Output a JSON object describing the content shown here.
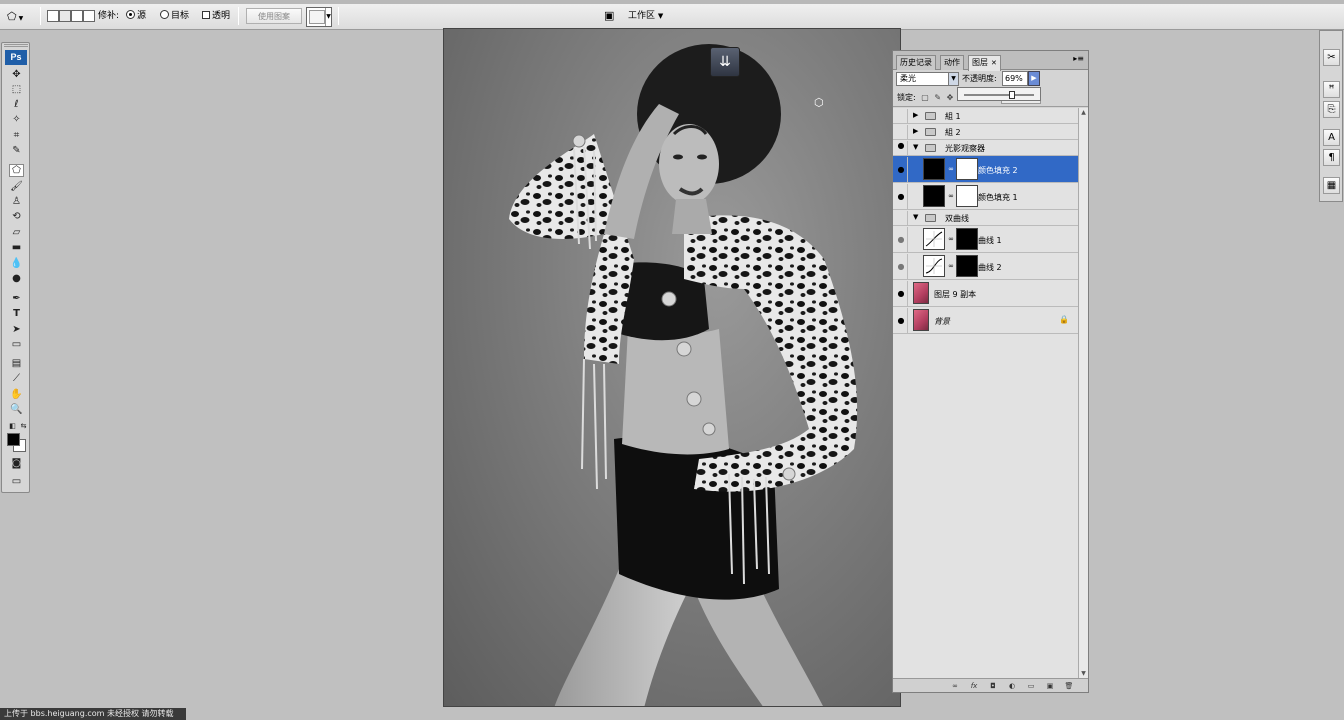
{
  "options_bar": {
    "repair_label": "修补:",
    "source_label": "源",
    "destination_label": "目标",
    "transparent_label": "透明",
    "use_pattern_label": "使用图案",
    "workspace_label": "工作区",
    "source_selected": true
  },
  "toolbox": {
    "logo": "Ps",
    "tools": [
      "move-icon",
      "marquee-icon",
      "lasso-icon",
      "magic-wand-icon",
      "crop-icon",
      "slice-icon",
      "patch-icon",
      "brush-icon",
      "clone-stamp-icon",
      "history-brush-icon",
      "eraser-icon",
      "gradient-icon",
      "blur-icon",
      "dodge-icon",
      "pen-icon",
      "type-icon",
      "path-select-icon",
      "shape-icon",
      "notes-icon",
      "eyedropper-icon",
      "hand-icon",
      "zoom-icon"
    ],
    "active_tool": "patch-icon",
    "foreground_color": "#000000",
    "background_color": "#ffffff"
  },
  "layers_panel": {
    "tabs": [
      {
        "label": "历史记录",
        "active": false
      },
      {
        "label": "动作",
        "active": false
      },
      {
        "label": "图层",
        "active": true
      }
    ],
    "blend_mode": "柔光",
    "opacity_label": "不透明度:",
    "opacity_value": "69%",
    "opacity_fraction": 0.69,
    "lock_label": "锁定:",
    "layers": [
      {
        "name": "組 1",
        "type": "group",
        "visible": false,
        "expanded": false,
        "indent": 0
      },
      {
        "name": "組 2",
        "type": "group",
        "visible": false,
        "expanded": false,
        "indent": 0
      },
      {
        "name": "光影观察器",
        "type": "group",
        "visible": true,
        "expanded": true,
        "indent": 0
      },
      {
        "name": "颜色填充 2",
        "type": "fill",
        "visible": true,
        "selected": true,
        "indent": 1
      },
      {
        "name": "颜色填充 1",
        "type": "fill",
        "visible": true,
        "indent": 1
      },
      {
        "name": "双曲线",
        "type": "group",
        "visible": false,
        "expanded": true,
        "indent": 0
      },
      {
        "name": "曲线 1",
        "type": "curves",
        "visible": true,
        "indent": 1
      },
      {
        "name": "曲线 2",
        "type": "curves",
        "visible": true,
        "indent": 1
      },
      {
        "name": "图层 9 副本",
        "type": "pixel",
        "visible": true,
        "indent": 0
      },
      {
        "name": "背景",
        "type": "pixel",
        "visible": true,
        "locked": true,
        "italic": true,
        "indent": 0
      }
    ]
  },
  "footer": {
    "watermark": "上传于 bbs.heiguang.com 未经授权 请勿转载"
  }
}
